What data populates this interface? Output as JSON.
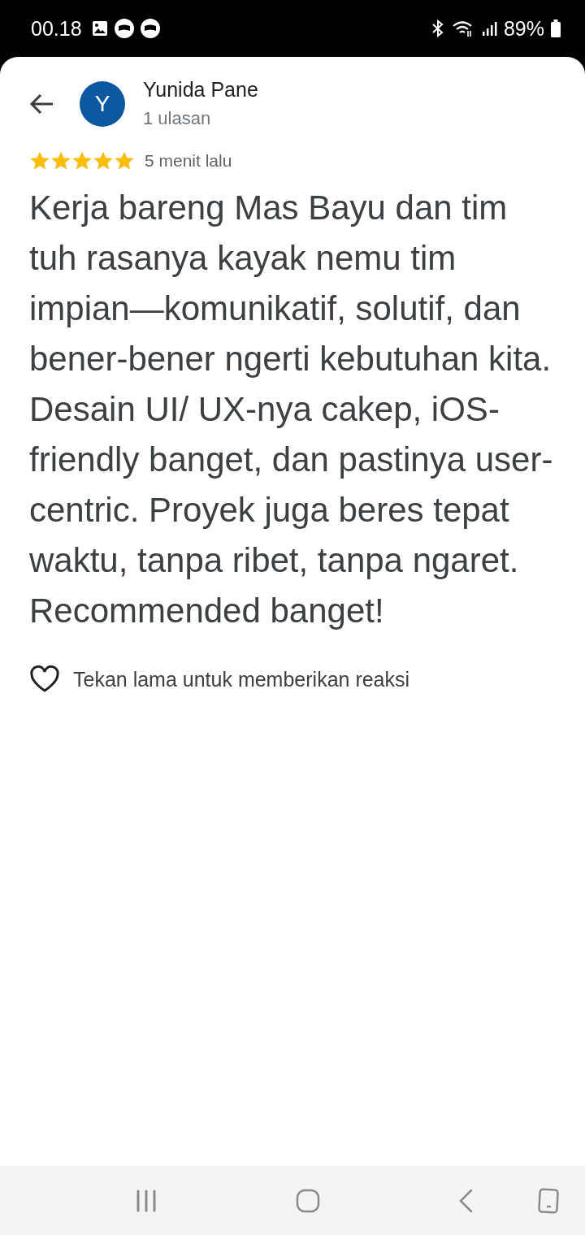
{
  "status_bar": {
    "time": "00.18",
    "battery": "89%"
  },
  "reviewer": {
    "initial": "Y",
    "name": "Yunida Pane",
    "count": "1 ulasan"
  },
  "review": {
    "stars": 5,
    "time": "5 menit lalu",
    "text": "Kerja bareng Mas Bayu dan tim tuh rasanya kayak nemu tim impian—komunikatif, solutif, dan bener-bener ngerti kebutuhan kita. Desain UI/ UX-nya cakep, iOS-friendly banget, dan pastinya user-centric. Proyek juga beres tepat waktu, tanpa ribet, tanpa ngaret. Recommended banget!",
    "reaction_hint": "Tekan lama untuk memberikan reaksi"
  }
}
